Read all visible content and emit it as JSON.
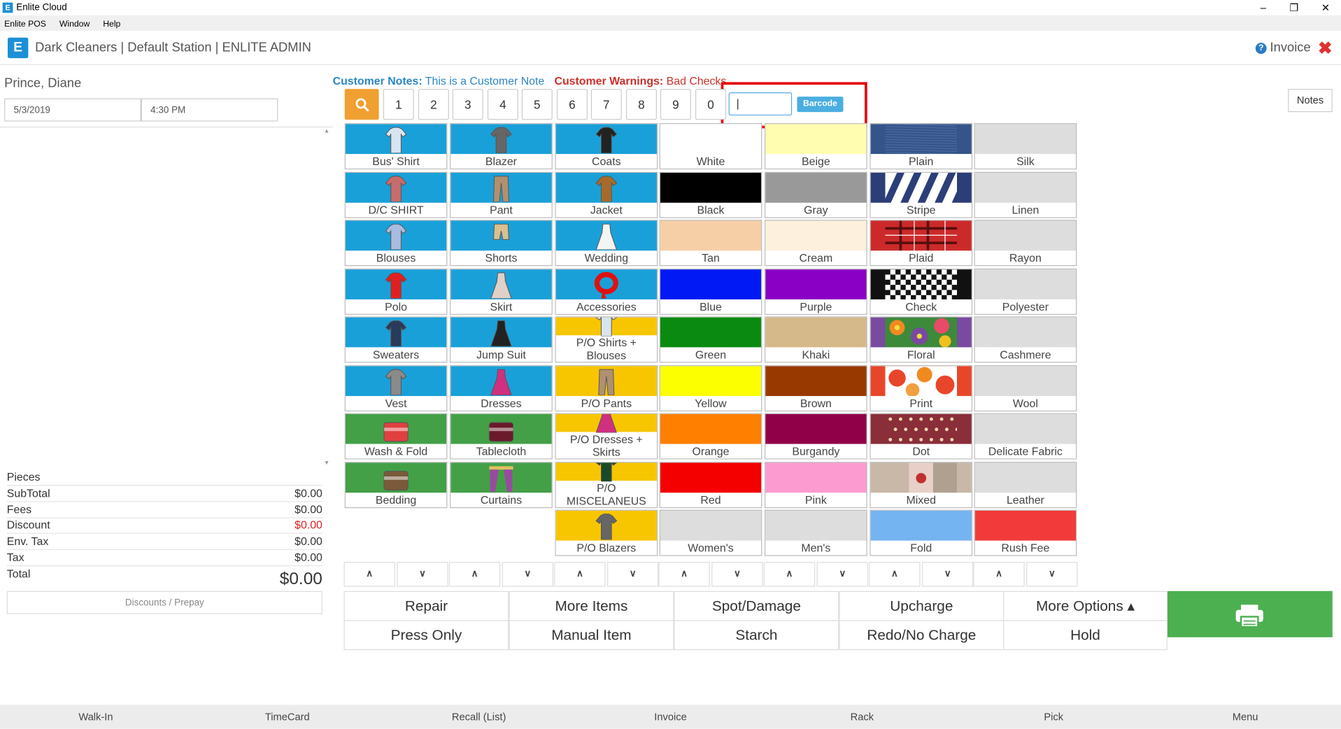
{
  "window": {
    "title": "Enlite Cloud",
    "logo": "E"
  },
  "menu": [
    "Enlite POS",
    "Window",
    "Help"
  ],
  "header": {
    "title": "Dark Cleaners | Default Station | ENLITE ADMIN",
    "invoice_label": "Invoice",
    "help_glyph": "?"
  },
  "customer": {
    "name": "Prince, Diane",
    "date": "5/3/2019",
    "time": "4:30 PM"
  },
  "notes": {
    "notes_label": "Customer Notes:",
    "notes_value": "This is a Customer Note",
    "warnings_label": "Customer Warnings:",
    "warnings_value": "Bad Checks"
  },
  "keypad": [
    "1",
    "2",
    "3",
    "4",
    "5",
    "6",
    "7",
    "8",
    "9",
    "0"
  ],
  "barcode": {
    "value": "|",
    "tag": "Barcode"
  },
  "notes_button": "Notes",
  "summary": [
    {
      "label": "Pieces",
      "value": ""
    },
    {
      "label": "SubTotal",
      "value": "$0.00"
    },
    {
      "label": "Fees",
      "value": "$0.00"
    },
    {
      "label": "Discount",
      "value": "$0.00"
    },
    {
      "label": "Env. Tax",
      "value": "$0.00"
    },
    {
      "label": "Tax",
      "value": "$0.00"
    },
    {
      "label": "Total",
      "value": "$0.00"
    }
  ],
  "discounts_button": "Discounts / Prepay",
  "columns": [
    [
      {
        "label": "Bus' Shirt",
        "color": "#1aa0d8",
        "icon": "shirt-icon"
      },
      {
        "label": "D/C SHIRT",
        "color": "#1aa0d8",
        "icon": "dress-shirt-icon"
      },
      {
        "label": "Blouses",
        "color": "#1aa0d8",
        "icon": "blouse-icon"
      },
      {
        "label": "Polo",
        "color": "#1aa0d8",
        "icon": "polo-icon"
      },
      {
        "label": "Sweaters",
        "color": "#1aa0d8",
        "icon": "sweater-icon"
      },
      {
        "label": "Vest",
        "color": "#1aa0d8",
        "icon": "vest-icon"
      },
      {
        "label": "Wash & Fold",
        "color": "#43a047",
        "icon": "towels-icon"
      },
      {
        "label": "Bedding",
        "color": "#43a047",
        "icon": "bed-icon"
      }
    ],
    [
      {
        "label": "Blazer",
        "color": "#1aa0d8",
        "icon": "blazer-icon"
      },
      {
        "label": "Pant",
        "color": "#1aa0d8",
        "icon": "pant-icon"
      },
      {
        "label": "Shorts",
        "color": "#1aa0d8",
        "icon": "shorts-icon"
      },
      {
        "label": "Skirt",
        "color": "#1aa0d8",
        "icon": "skirt-icon"
      },
      {
        "label": "Jump Suit",
        "color": "#1aa0d8",
        "icon": "jumpsuit-icon"
      },
      {
        "label": "Dresses",
        "color": "#1aa0d8",
        "icon": "dress-icon"
      },
      {
        "label": "Tablecloth",
        "color": "#43a047",
        "icon": "tablecloth-icon"
      },
      {
        "label": "Curtains",
        "color": "#43a047",
        "icon": "curtains-icon"
      }
    ],
    [
      {
        "label": "Coats",
        "color": "#1aa0d8",
        "icon": "coat-icon"
      },
      {
        "label": "Jacket",
        "color": "#1aa0d8",
        "icon": "jacket-icon"
      },
      {
        "label": "Wedding",
        "color": "#1aa0d8",
        "icon": "wedding-dress-icon"
      },
      {
        "label": "Accessories",
        "color": "#1aa0d8",
        "icon": "scarf-icon"
      },
      {
        "label": "P/O Shirts + Blouses",
        "color": "#f7c600",
        "icon": "shirt-icon"
      },
      {
        "label": "P/O Pants",
        "color": "#f7c600",
        "icon": "pant-icon"
      },
      {
        "label": "P/O Dresses + Skirts",
        "color": "#f7c600",
        "icon": "dress-icon"
      },
      {
        "label": "P/O MISCELANEUS",
        "color": "#f7c600",
        "icon": "misc-icon"
      },
      {
        "label": "P/O Blazers",
        "color": "#f7c600",
        "icon": "blazer-icon"
      }
    ],
    [
      {
        "label": "White",
        "color": "#ffffff"
      },
      {
        "label": "Black",
        "color": "#000000"
      },
      {
        "label": "Tan",
        "color": "#f7cfa6"
      },
      {
        "label": "Blue",
        "color": "#0019f5"
      },
      {
        "label": "Green",
        "color": "#0a8a10"
      },
      {
        "label": "Yellow",
        "color": "#fbff00"
      },
      {
        "label": "Orange",
        "color": "#ff7f00"
      },
      {
        "label": "Red",
        "color": "#f40000"
      },
      {
        "label": "Women's",
        "color": "#dddddd"
      }
    ],
    [
      {
        "label": "Beige",
        "color": "#fffdb0"
      },
      {
        "label": "Gray",
        "color": "#999999"
      },
      {
        "label": "Cream",
        "color": "#fdf0dc"
      },
      {
        "label": "Purple",
        "color": "#8a00c4"
      },
      {
        "label": "Khaki",
        "color": "#d6b98a"
      },
      {
        "label": "Brown",
        "color": "#983a00"
      },
      {
        "label": "Burgandy",
        "color": "#900048"
      },
      {
        "label": "Pink",
        "color": "#fc9bd0"
      },
      {
        "label": "Men's",
        "color": "#dddddd"
      }
    ],
    [
      {
        "label": "Plain",
        "color": "#35558a",
        "icon": "plain-fabric-icon"
      },
      {
        "label": "Stripe",
        "color": "#2c3e78",
        "icon": "stripe-pattern-icon"
      },
      {
        "label": "Plaid",
        "color": "#cc2a2a",
        "icon": "plaid-pattern-icon"
      },
      {
        "label": "Check",
        "color": "#111111",
        "icon": "check-pattern-icon"
      },
      {
        "label": "Floral",
        "color": "#7a4aa0",
        "icon": "floral-pattern-icon"
      },
      {
        "label": "Print",
        "color": "#e8462a",
        "icon": "print-pattern-icon"
      },
      {
        "label": "Dot",
        "color": "#8a2e3a",
        "icon": "dot-pattern-icon"
      },
      {
        "label": "Mixed",
        "color": "#c9b8a8",
        "icon": "mixed-pattern-icon"
      },
      {
        "label": "Fold",
        "color": "#74b4f0"
      }
    ],
    [
      {
        "label": "Silk",
        "color": "#dddddd"
      },
      {
        "label": "Linen",
        "color": "#dddddd"
      },
      {
        "label": "Rayon",
        "color": "#dddddd"
      },
      {
        "label": "Polyester",
        "color": "#dddddd"
      },
      {
        "label": "Cashmere",
        "color": "#dddddd"
      },
      {
        "label": "Wool",
        "color": "#dddddd"
      },
      {
        "label": "Delicate Fabric",
        "color": "#dddddd"
      },
      {
        "label": "Leather",
        "color": "#dddddd"
      },
      {
        "label": "Rush Fee",
        "color": "#f23a3a"
      }
    ]
  ],
  "actions_row1": [
    "Repair",
    "More Items",
    "Spot/Damage",
    "Upcharge",
    "More Options ▴"
  ],
  "actions_row2": [
    "Press Only",
    "Manual Item",
    "Starch",
    "Redo/No Charge",
    "Hold"
  ],
  "bottom": [
    "Walk-In",
    "TimeCard",
    "Recall (List)",
    "Invoice",
    "Rack",
    "Pick",
    "Menu"
  ],
  "colors": {
    "accent": "#1c8fd6",
    "search": "#f0a030",
    "print": "#4cb050",
    "warning": "#c9302c"
  }
}
